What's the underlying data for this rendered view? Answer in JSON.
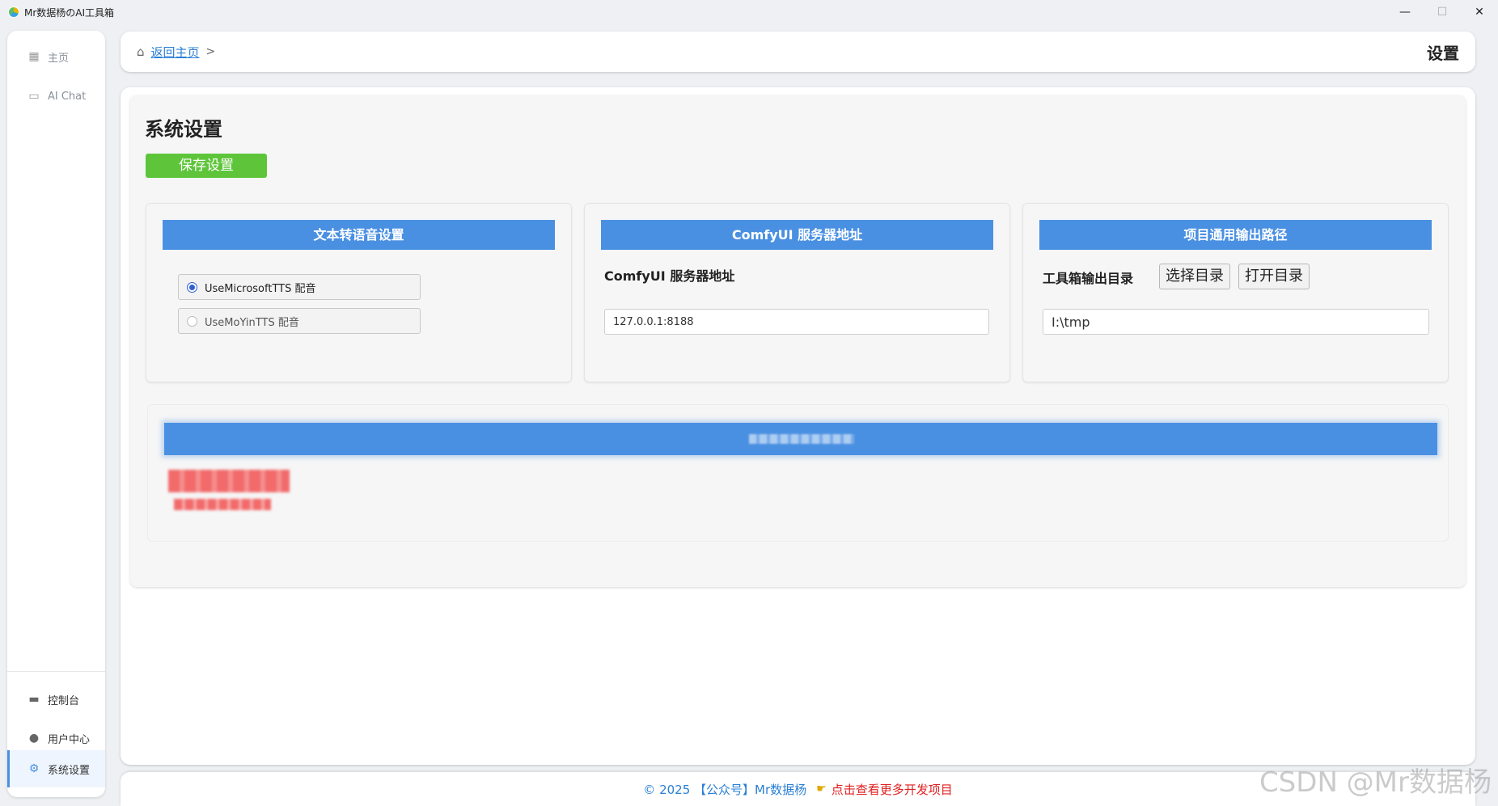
{
  "window": {
    "title": "Mr数据杨のAI工具箱",
    "controls": [
      "—",
      "☐",
      "✕"
    ]
  },
  "sidebar": {
    "top_items": [
      {
        "label": "主页",
        "icon": "grid-icon"
      },
      {
        "label": "AI Chat",
        "icon": "chat-icon"
      }
    ],
    "bottom_items": [
      {
        "label": "控制台",
        "icon": "monitor-icon"
      },
      {
        "label": "用户中心",
        "icon": "user-icon"
      },
      {
        "label": "系统设置",
        "icon": "gear-icon"
      }
    ],
    "active": "系统设置"
  },
  "header": {
    "back_link": "返回主页",
    "separator": ">",
    "title": "设置"
  },
  "settings": {
    "title": "系统设置",
    "save_label": "保存设置",
    "tts": {
      "heading": "文本转语音设置",
      "options": [
        {
          "label": "UseMicrosoftTTS 配音",
          "selected": true
        },
        {
          "label": "UseMoYinTTS 配音",
          "selected": false
        }
      ]
    },
    "comfyui": {
      "heading": "ComfyUI 服务器地址",
      "field_label": "ComfyUI 服务器地址",
      "value": "127.0.0.1:8188"
    },
    "output": {
      "heading": "项目通用输出路径",
      "field_label": "工具箱输出目录",
      "choose_label": "选择目录",
      "open_label": "打开目录",
      "value": "I:\\tmp"
    }
  },
  "footer": {
    "copyright": "© 2025 【公众号】Mr数据杨",
    "more_link": "点击查看更多开发项目"
  },
  "watermark": "CSDN @Mr数据杨",
  "colors": {
    "accent_blue": "#4a90e2",
    "save_green": "#5ec53a",
    "link_blue": "#2a7fd5",
    "link_red": "#e02020"
  }
}
